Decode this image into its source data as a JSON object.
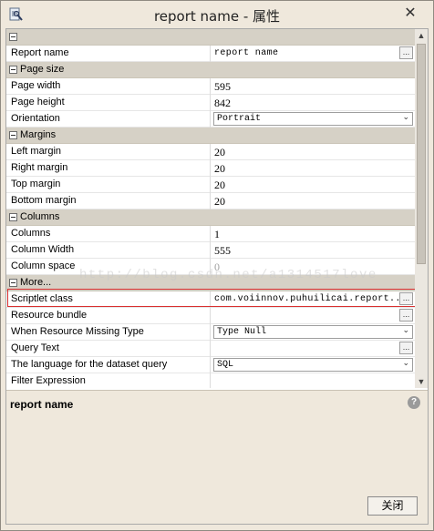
{
  "window": {
    "title": "report name - 属性",
    "close_glyph": "✕"
  },
  "properties": [
    {
      "kind": "category",
      "label": ""
    },
    {
      "kind": "prop",
      "name": "Report name",
      "value": "report name",
      "editor": "text-ellipsis"
    },
    {
      "kind": "category",
      "label": "Page size"
    },
    {
      "kind": "prop",
      "name": "Page width",
      "value": "595",
      "editor": "text"
    },
    {
      "kind": "prop",
      "name": "Page height",
      "value": "842",
      "editor": "text"
    },
    {
      "kind": "prop",
      "name": "Orientation",
      "value": "Portrait",
      "editor": "combo"
    },
    {
      "kind": "category",
      "label": "Margins"
    },
    {
      "kind": "prop",
      "name": "Left margin",
      "value": "20",
      "editor": "text"
    },
    {
      "kind": "prop",
      "name": "Right margin",
      "value": "20",
      "editor": "text"
    },
    {
      "kind": "prop",
      "name": "Top margin",
      "value": "20",
      "editor": "text"
    },
    {
      "kind": "prop",
      "name": "Bottom margin",
      "value": "20",
      "editor": "text"
    },
    {
      "kind": "category",
      "label": "Columns"
    },
    {
      "kind": "prop",
      "name": "Columns",
      "value": "1",
      "editor": "text"
    },
    {
      "kind": "prop",
      "name": "Column Width",
      "value": "555",
      "editor": "text"
    },
    {
      "kind": "prop",
      "name": "Column space",
      "value": "0",
      "editor": "text-disabled"
    },
    {
      "kind": "category",
      "label": "More..."
    },
    {
      "kind": "prop",
      "name": "Scriptlet class",
      "value": "com.voiinnov.puhuilicai.report...",
      "editor": "text-ellipsis",
      "highlighted": true
    },
    {
      "kind": "prop",
      "name": "Resource bundle",
      "value": "",
      "editor": "text-ellipsis"
    },
    {
      "kind": "prop",
      "name": "When Resource Missing Type",
      "value": "Type Null",
      "editor": "combo"
    },
    {
      "kind": "prop",
      "name": "Query Text",
      "value": "",
      "editor": "text-ellipsis"
    },
    {
      "kind": "prop",
      "name": "The language for the dataset query",
      "value": "SQL",
      "editor": "combo"
    },
    {
      "kind": "prop",
      "name": "Filter Expression",
      "value": "",
      "editor": "text"
    }
  ],
  "ellipsis_label": "...",
  "description": {
    "title": "report name",
    "help_glyph": "?"
  },
  "footer": {
    "close_label": "关闭"
  },
  "watermark": "http://blog.csdn.net/a1314517love",
  "colors": {
    "category_bg": "#d6d1c6",
    "highlight_border": "#d93030",
    "panel_bg": "#efe8dc"
  }
}
